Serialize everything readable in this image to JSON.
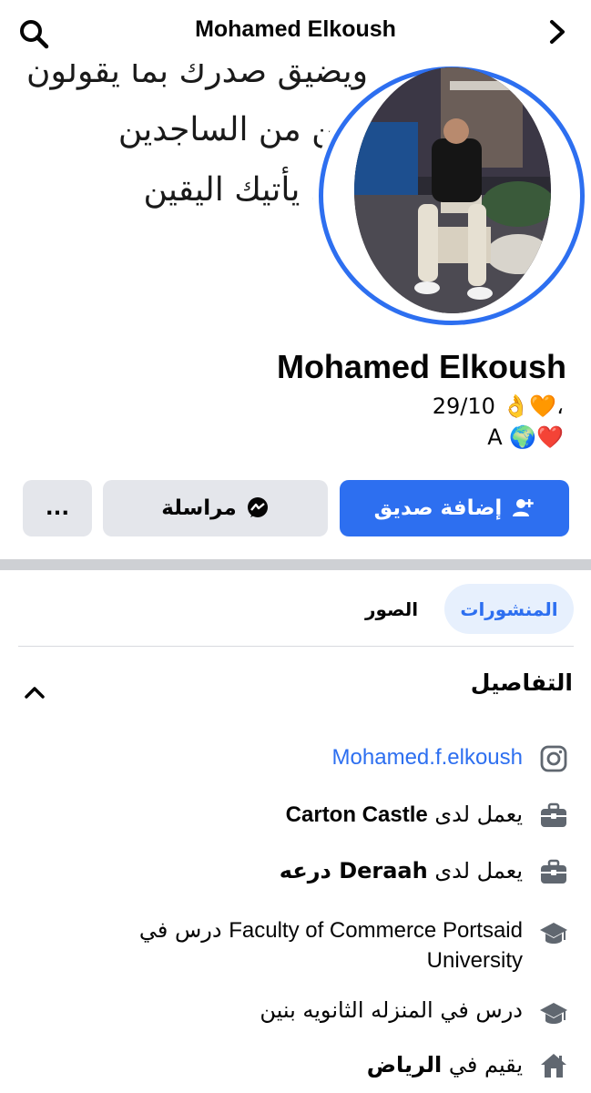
{
  "header": {
    "title": "Mohamed Elkoush"
  },
  "cover": {
    "calligraphy_lines": [
      "ويضيق صدرك بما يقولون",
      "وكن من الساجدين",
      "حتى يأتيك اليقين"
    ]
  },
  "profile": {
    "name": "Mohamed Elkoush",
    "bio_line1": "29/10 👌🧡،",
    "bio_line2": "A 🌍❤️"
  },
  "actions": {
    "add_friend": "إضافة صديق",
    "message": "مراسلة",
    "more": "..."
  },
  "tabs": {
    "posts": "المنشورات",
    "photos": "الصور"
  },
  "details": {
    "title": "التفاصيل",
    "instagram": "Mohamed.f.elkoush",
    "work1_prefix": "يعمل لدى",
    "work1_place": "Carton Castle",
    "work2_prefix": "يعمل لدى",
    "work2_place": "Deraah درعه",
    "edu1_prefix": "درس في",
    "edu1_place": "Faculty of Commerce Portsaid University",
    "edu2": "درس في المنزله الثانويه بنين",
    "lives_prefix": "يقيم في",
    "lives_place": "الرياض"
  },
  "colors": {
    "accent": "#2d6ff0",
    "button_gray": "#e4e6eb",
    "tab_active_bg": "#e7f0fd"
  }
}
